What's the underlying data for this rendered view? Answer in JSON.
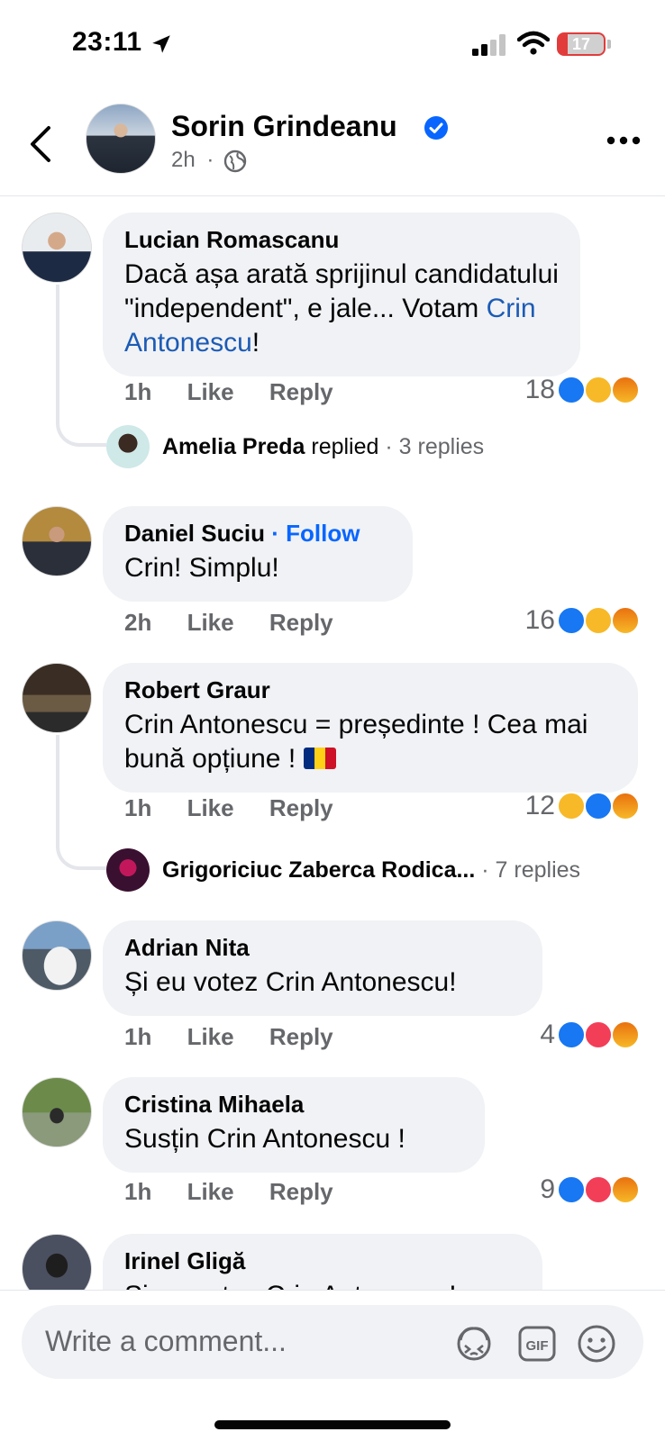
{
  "status_bar": {
    "time": "23:11",
    "battery": "17"
  },
  "post": {
    "author": "Sorin Grindeanu",
    "time": "2h",
    "separator": "·"
  },
  "comments": [
    {
      "name": "Lucian Romascanu",
      "text_before": "Dacă așa arată sprijinul candidatului \"independent\", e jale... Votam ",
      "link": "Crin Antonescu",
      "text_after": "!",
      "time": "1h",
      "like": "Like",
      "reply": "Reply",
      "count": "18",
      "reply_preview": {
        "name": "Amelia Preda",
        "verb": "replied",
        "count": "· 3 replies"
      }
    },
    {
      "name": "Daniel Suciu",
      "follow": "· Follow",
      "text": "Crin! Simplu!",
      "time": "2h",
      "like": "Like",
      "reply": "Reply",
      "count": "16"
    },
    {
      "name": "Robert Graur",
      "text": "Crin Antonescu = președinte ! Cea mai bună opțiune !",
      "time": "1h",
      "like": "Like",
      "reply": "Reply",
      "count": "12",
      "reply_preview": {
        "name": "Grigoriciuc Zaberca Rodica...",
        "count": "· 7 replies"
      }
    },
    {
      "name": "Adrian Nita",
      "text": "Și eu votez Crin Antonescu!",
      "time": "1h",
      "like": "Like",
      "reply": "Reply",
      "count": "4"
    },
    {
      "name": "Cristina Mihaela",
      "text": "Susțin Crin Antonescu !",
      "time": "1h",
      "like": "Like",
      "reply": "Reply",
      "count": "9"
    },
    {
      "name": "Irinel Gligă",
      "text": "Și eu votez Crin Antonescu!"
    }
  ],
  "composer": {
    "placeholder": "Write a comment...",
    "gif": "GIF"
  },
  "colors": {
    "link": "#1c5bb5",
    "follow": "#0866ff",
    "like": "#1877f2",
    "haha": "#f7b928",
    "love": "#f33e58",
    "bubble": "#f0f2f5"
  }
}
